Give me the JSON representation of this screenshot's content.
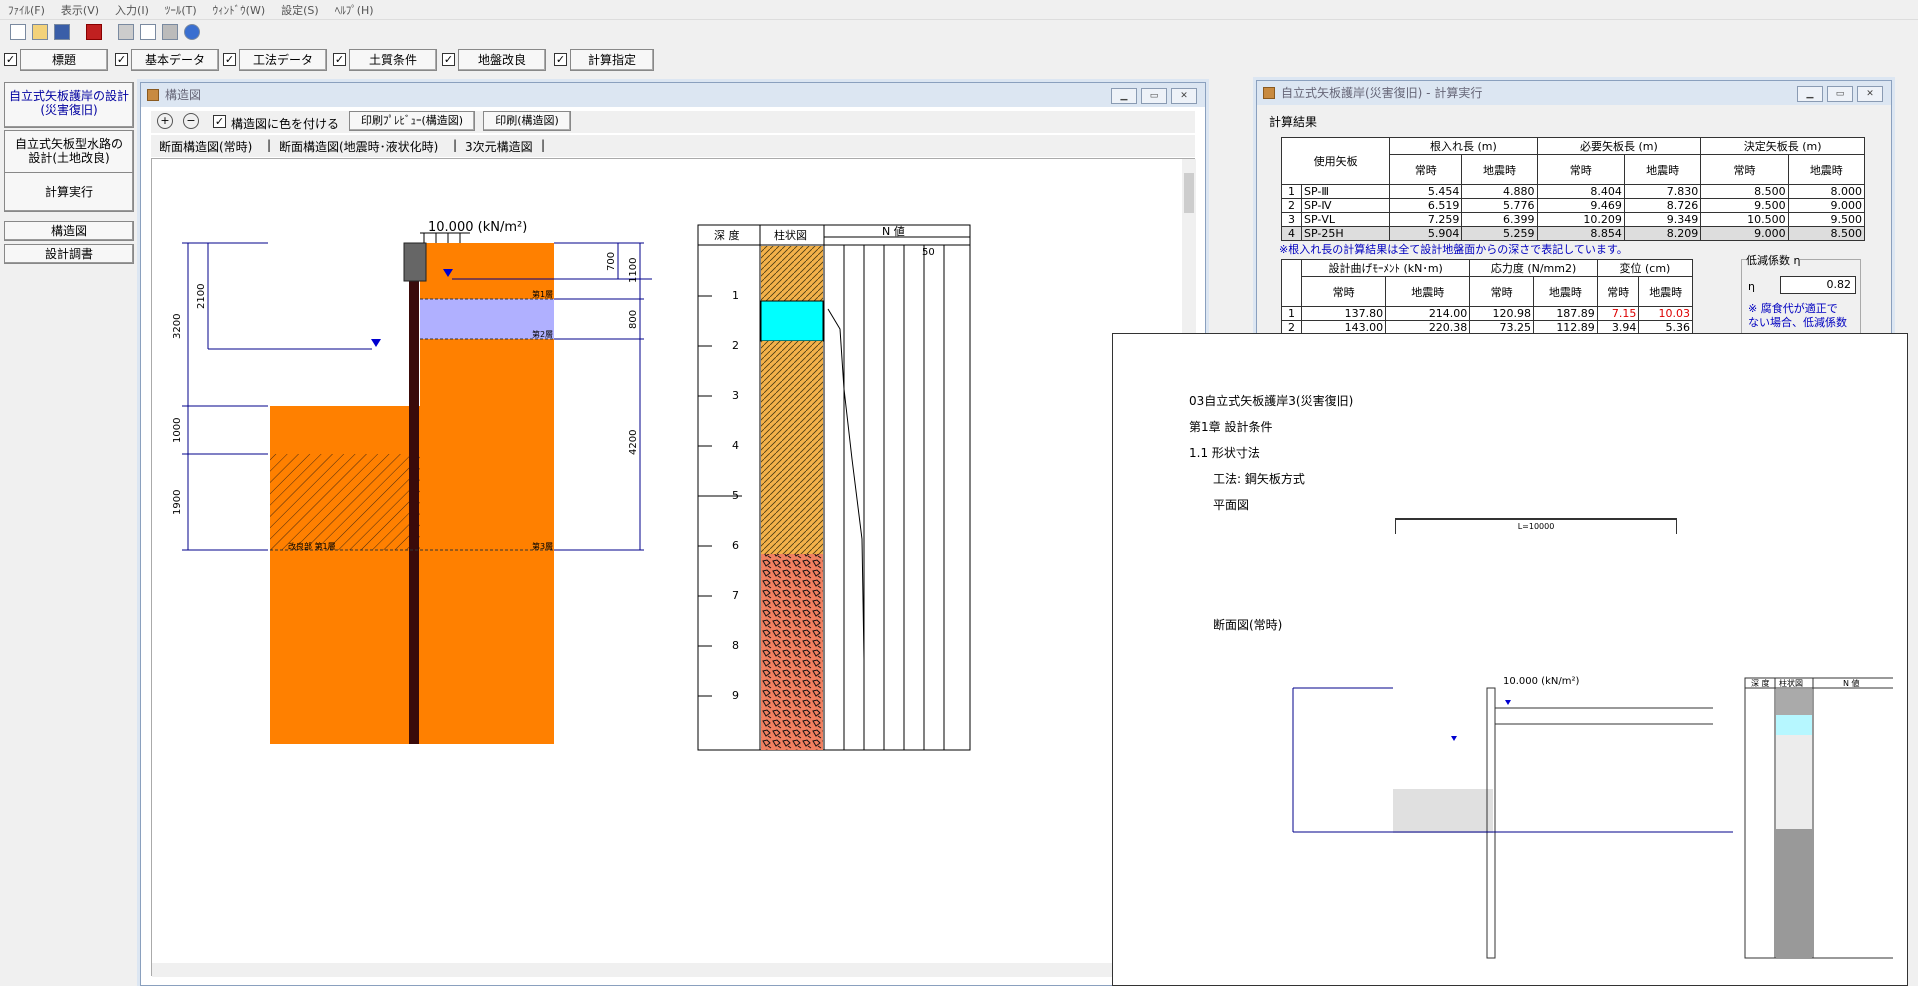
{
  "menu": [
    "ﾌｧｲﾙ(F)",
    "表示(V)",
    "入力(I)",
    "ﾂｰﾙ(T)",
    "ｳｨﾝﾄﾞｳ(W)",
    "設定(S)",
    "ﾍﾙﾌﾟ(H)"
  ],
  "toolbar_buttons": [
    "標題",
    "基本データ",
    "工法データ",
    "土質条件",
    "地盤改良",
    "計算指定"
  ],
  "left_buttons": {
    "design1_line1": "自立式矢板護岸の設計",
    "design1_line2": "(災害復旧)",
    "design2_line1": "自立式矢板型水路の",
    "design2_line2": "設計(土地改良)",
    "calc": "計算実行",
    "structure": "構造図",
    "report": "設計調書"
  },
  "win1": {
    "title": "構造図",
    "color_check": "構造図に色を付ける",
    "print_preview": "印刷ﾌﾟﾚﾋﾞｭｰ(構造図)",
    "print": "印刷(構造図)",
    "tabs": [
      "断面構造図(常時)",
      "断面構造図(地震時･液状化時)",
      "3次元構造図"
    ]
  },
  "drawing": {
    "load": "10.000 (kN/m²)",
    "dims_left": [
      "3200",
      "2100",
      "1000",
      "1900"
    ],
    "dims_right": [
      "700",
      "1100",
      "800",
      "4200"
    ],
    "layers": [
      "第1層",
      "第2層",
      "第3層"
    ],
    "improved": "改良部 第1層"
  },
  "boring": {
    "h_depth": "深 度",
    "h_column": "柱状図",
    "h_n": "N 値",
    "n_mark": "50",
    "depths": [
      "1",
      "2",
      "3",
      "4",
      "5",
      "6",
      "7",
      "8",
      "9"
    ]
  },
  "win2": {
    "title": "自立式矢板護岸(災害復旧) - 計算実行",
    "result_label": "計算結果",
    "group1": [
      "根入れ長 (m)",
      "必要矢板長 (m)",
      "決定矢板長 (m)"
    ],
    "col_sheet": "使用矢板",
    "col_normal": "常時",
    "col_eq": "地震時",
    "rows": [
      {
        "no": "1",
        "name": "SP-Ⅲ",
        "v": [
          "5.454",
          "4.880",
          "8.404",
          "7.830",
          "8.500",
          "8.000"
        ]
      },
      {
        "no": "2",
        "name": "SP-Ⅳ",
        "v": [
          "6.519",
          "5.776",
          "9.469",
          "8.726",
          "9.500",
          "9.000"
        ]
      },
      {
        "no": "3",
        "name": "SP-ⅤL",
        "v": [
          "7.259",
          "6.399",
          "10.209",
          "9.349",
          "10.500",
          "9.500"
        ]
      },
      {
        "no": "4",
        "name": "SP-25H",
        "v": [
          "5.904",
          "5.259",
          "8.854",
          "8.209",
          "9.000",
          "8.500"
        ]
      }
    ],
    "note": "※根入れ長の計算結果は全て設計地盤面からの深さで表記しています。",
    "group2": [
      "設計曲げﾓｰﾒﾝﾄ (kN･m)",
      "応力度 (N/mm2)",
      "変位 (cm)"
    ],
    "rows2": [
      {
        "no": "1",
        "v": [
          "137.80",
          "214.00",
          "120.98",
          "187.89",
          "7.15",
          "10.03"
        ]
      },
      {
        "no": "2",
        "v": [
          "143.00",
          "220.38",
          "73.25",
          "112.89",
          "3.94",
          "5.36"
        ]
      }
    ],
    "reduce_label": "低減係数 η",
    "eta": "η",
    "eta_value": "0.82",
    "reduce_note1": "※ 腐食代が適正で",
    "reduce_note2": "ない場合、低減係数"
  },
  "win3": {
    "title": "03自立式矢板護岸3(災害復旧)",
    "chapter": "第1章 設計条件",
    "section": "1.1 形状寸法",
    "method": "工法: 鋼矢板方式",
    "plan": "平面図",
    "plan_len": "L=10000",
    "section_title": "断面図(常時)"
  }
}
